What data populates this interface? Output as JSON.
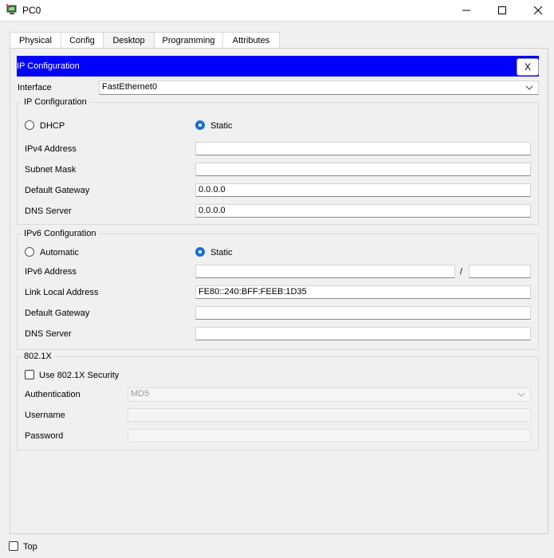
{
  "window": {
    "title": "PC0"
  },
  "tabs": [
    {
      "label": "Physical"
    },
    {
      "label": "Config"
    },
    {
      "label": "Desktop"
    },
    {
      "label": "Programming"
    },
    {
      "label": "Attributes"
    }
  ],
  "active_tab": "Desktop",
  "header": {
    "title": "IP Configuration",
    "close_label": "X"
  },
  "interface": {
    "label": "Interface",
    "value": "FastEthernet0"
  },
  "ipv4": {
    "group_title": "IP Configuration",
    "dhcp_label": "DHCP",
    "static_label": "Static",
    "mode": "Static",
    "ipv4_address_label": "IPv4 Address",
    "ipv4_address_value": "",
    "subnet_mask_label": "Subnet Mask",
    "subnet_mask_value": "",
    "default_gateway_label": "Default Gateway",
    "default_gateway_value": "0.0.0.0",
    "dns_server_label": "DNS Server",
    "dns_server_value": "0.0.0.0"
  },
  "ipv6": {
    "group_title": "IPv6 Configuration",
    "automatic_label": "Automatic",
    "static_label": "Static",
    "mode": "Static",
    "ipv6_address_label": "IPv6 Address",
    "ipv6_address_value": "",
    "prefix_separator": "/",
    "prefix_value": "",
    "link_local_label": "Link Local Address",
    "link_local_value": "FE80::240:BFF:FEEB:1D35",
    "default_gateway_label": "Default Gateway",
    "default_gateway_value": "",
    "dns_server_label": "DNS Server",
    "dns_server_value": ""
  },
  "dot1x": {
    "group_title": "802.1X",
    "use_label": "Use 802.1X Security",
    "use_checked": false,
    "authentication_label": "Authentication",
    "authentication_value": "MD5",
    "username_label": "Username",
    "username_value": "",
    "password_label": "Password",
    "password_value": ""
  },
  "footer": {
    "top_label": "Top",
    "top_checked": false
  },
  "colors": {
    "header_bg": "#0000ff",
    "radio_on": "#1a6fd1",
    "active_tab_underline": "#1b3a8a"
  }
}
